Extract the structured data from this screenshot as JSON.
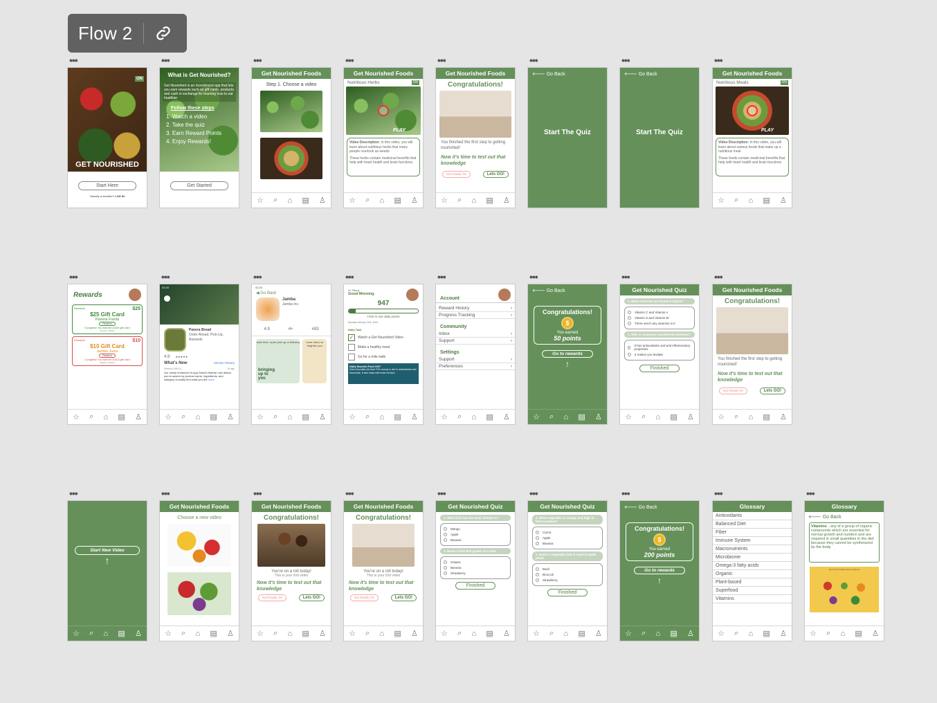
{
  "flow_label": "Flow 2",
  "nav_icons": [
    "star-icon",
    "search-icon",
    "home-icon",
    "book-icon",
    "profile-icon"
  ],
  "nav_glyphs": [
    "☆",
    "⌕",
    "⌂",
    "▤",
    "♙"
  ],
  "s1": {
    "brand": "GET NOURISHED",
    "badge": "ON",
    "button": "Start Here",
    "member": "Already a member?",
    "login": "LOG IN"
  },
  "s2": {
    "title": "What is Get Nourished?",
    "body": "Get Nourished is an incentivized app that lets you earn rewards such as gift cards, products and cash in exchange for learning how to eat healthier",
    "steps_title": "Follow these steps",
    "steps": [
      "1. Watch a video",
      "2. Take the quiz",
      "3. Earn Reward Points",
      "4. Enjoy Rewards!"
    ],
    "button": "Get Started"
  },
  "s3": {
    "header": "Get Nourished Foods",
    "prompt": "Step 1. Choose a video"
  },
  "s4": {
    "header": "Get Nourished Foods",
    "sub": "Nutritious Herbs",
    "badge": "ON",
    "play": "PLAY",
    "desc_label": "Video Description:",
    "desc": "In this video, you will learn about nutritious herbs that many people overlook as weeds",
    "desc2": "These herbs contain medicinal benefits that help with heart health and brain functions"
  },
  "s5": {
    "header": "Get Nourished Foods",
    "title": "Congratulations!",
    "text": "You finished the first step to getting nourished!",
    "cta": "Now it's time to test out that knowledge",
    "no": "Not Ready Yet",
    "yes": "Lets GO!"
  },
  "s6": {
    "back": "Go Back",
    "center": "Start The Quiz"
  },
  "s7": {
    "back": "Go Back",
    "center": "Start The Quiz"
  },
  "s8": {
    "header": "Get Nourished Foods",
    "sub": "Nutritious Meals",
    "badge": "ON",
    "play": "PLAY",
    "desc_label": "Video Description:",
    "desc": "In this video, you will learn about various foods that make up a nutritious meal",
    "desc2": "These foods contain medicinal benefits that help with heart health and brain functions"
  },
  "r1": {
    "title": "Rewards",
    "card1_tag": "Rewards",
    "card1_amt": "$25",
    "card1_title": "$25 Gift Card",
    "card1_vendor": "Panera Foods",
    "card1_redeem": "Redeem",
    "card1_msg": "Congrats! You earned a $25 gift card",
    "card1_exp": "Expires 7/31/24",
    "card2_tag": "Rewards",
    "card2_amt": "$10",
    "card2_title": "$10 Gift Card",
    "card2_vendor": "Jamba Juice",
    "card2_redeem": "Redeem",
    "card2_msg": "Congrats! You earned a $10 gift card",
    "card2_exp": "Expires 7/31/24"
  },
  "r2": {
    "time": "02:20",
    "app": "Panera Bread",
    "dev": "Order Ahead, Pick-Up, Rewards",
    "rating": "4.9",
    "stars": "★★★★★",
    "whatsnew": "What's New",
    "version_hist": "Version History",
    "version": "Version 4.89.0.0",
    "ago": "2d ago",
    "notes": "Our newly enhanced in-app Search feature now allows you to search by product name, ingredients, and category to easily find what you are",
    "more": "more"
  },
  "r3": {
    "time": "02:20",
    "back": "Go Back",
    "app": "Jamba",
    "dev": "Jamba Inc.",
    "rating": "4.9",
    "age": "4+",
    "rank": "#83",
    "banner1": "save time: order pick-up or delivery",
    "banner2": "more menu to brighten you",
    "promo": "bringing up to you"
  },
  "r4": {
    "greet": "Hi Tiffany",
    "morning": "Good Morning",
    "points": "947",
    "daily": "Click to see daily points",
    "date": "Monday January 21st, 2024",
    "task_title": "Daily Task",
    "tasks": [
      "Watch a Get Nourished Video",
      "Make a healthy meal",
      "Go for a mile walk"
    ],
    "fact_title": "Daily Nourish Fact #267",
    "fact": "Dark chocolate (at least 70% cocoa) is rich in antioxidants and flavonoids. It also helps with brain function"
  },
  "r5": {
    "account": "Account",
    "items_a": [
      "Reward History",
      "Progress Tracking"
    ],
    "community": "Community",
    "items_c": [
      "Inbox",
      "Support"
    ],
    "settings": "Settings",
    "items_s": [
      "Support",
      "Preferences"
    ]
  },
  "r6": {
    "back": "Go Back",
    "title": "Congratulations!",
    "earned": "You earned",
    "points": "50 points",
    "button": "Go to rewards"
  },
  "r7": {
    "header": "Get Nourished Quiz",
    "q1": "1. What nutrients are found in thyme?",
    "q1_opts": [
      "Vitamin C and Vitamin A",
      "Vitamin S and Vitamin W",
      "There aren't any vitamins in it"
    ],
    "q2": "1. Why is rosemary considered nutritious?",
    "q2_opts": [
      "It has antioxidants and anti-inflammatory properties",
      "It makes you levitate"
    ],
    "button": "Finished"
  },
  "r8": {
    "header": "Get Nourished Foods",
    "title": "Congratulations!",
    "text": "You finished the first step to getting nourished!",
    "cta": "Now it's time to test out that knowledge",
    "no": "Not Ready Yet",
    "yes": "Lets GO!"
  },
  "t1": {
    "button": "Start New Video"
  },
  "t2": {
    "header": "Get Nourished Foods",
    "prompt": "Choose a new video"
  },
  "t3": {
    "header": "Get Nourished Foods",
    "title": "Congratulations!",
    "text": "You're on a roll today!",
    "sub": "This is your 2nd video",
    "cta": "Now it's time to test out that knowledge",
    "no": "Not Ready Yet",
    "yes": "Lets GO!"
  },
  "t4": {
    "header": "Get Nourished Foods",
    "title": "Congratulations!",
    "text": "You're on a roll today!",
    "sub": "This is your 2nd video",
    "cta": "Now it's time to test out that knowledge",
    "no": "Not Ready Yet",
    "yes": "Lets GO!"
  },
  "t5": {
    "header": "Get Nourished Quiz",
    "q1": "1. What fruit has the most Vitamin A?",
    "q1_opts": [
      "Mango",
      "Apple",
      "Banana"
    ],
    "q2": "1. Name a fruit that grows on a vine",
    "q2_opts": [
      "Grapes",
      "Banana",
      "Strawberry"
    ],
    "button": "Finished"
  },
  "t6": {
    "header": "Get Nourished Quiz",
    "q1": "1. What vegetable is orange and high in beta-carotene?",
    "q1_opts": [
      "Carrot",
      "Apple",
      "Banana"
    ],
    "q2": "1. Name a vegetable that is used to make pesto",
    "q2_opts": [
      "Basil",
      "Broccoli",
      "Strawberry"
    ],
    "button": "Finished"
  },
  "t7": {
    "back": "Go Back",
    "title": "Congratulations!",
    "earned": "You earned",
    "points": "200 points",
    "button": "Go to rewards"
  },
  "t8": {
    "header": "Glossary",
    "items": [
      "Antioxidants",
      "Balanced Diet",
      "Fiber",
      "Immune System",
      "Macronutrients",
      "Microbiome",
      "Omega-3 fatty acids",
      "Organic",
      "Plant-based",
      "Superfood",
      "Vitamins"
    ]
  },
  "t9": {
    "header": "Glossary",
    "back": "Go Back",
    "term": "Vitamins",
    "def": " - any of a group of organic compounds which are essential for normal growth and nutrition and are required in small quantities in the diet because they cannot be synthesized by the body.",
    "chart_title": "Top 10 Anti-Inflammatory Vitamins"
  }
}
